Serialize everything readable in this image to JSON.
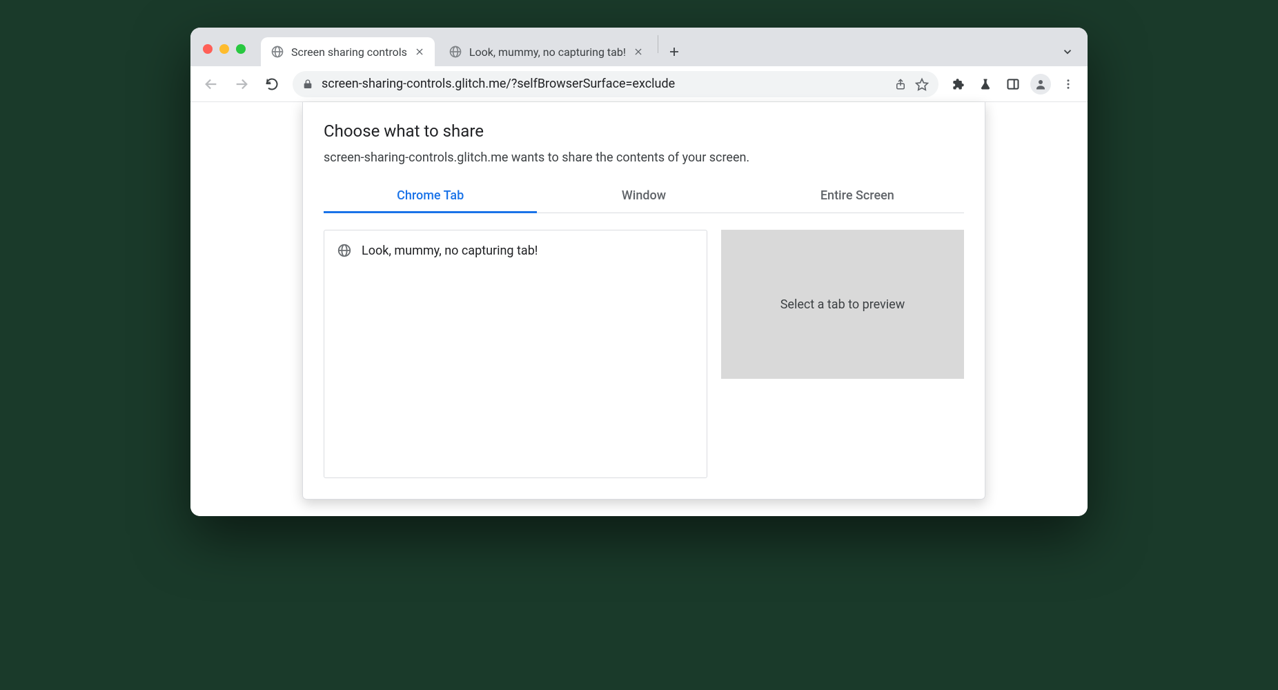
{
  "browser": {
    "tabs": [
      {
        "title": "Screen sharing controls",
        "active": true
      },
      {
        "title": "Look, mummy, no capturing tab!",
        "active": false
      }
    ],
    "url": "screen-sharing-controls.glitch.me/?selfBrowserSurface=exclude"
  },
  "dialog": {
    "title": "Choose what to share",
    "subtitle": "screen-sharing-controls.glitch.me wants to share the contents of your screen.",
    "tabs": {
      "chrome_tab": "Chrome Tab",
      "window": "Window",
      "entire_screen": "Entire Screen",
      "active": "chrome_tab"
    },
    "list_items": [
      {
        "title": "Look, mummy, no capturing tab!"
      }
    ],
    "preview_placeholder": "Select a tab to preview"
  }
}
